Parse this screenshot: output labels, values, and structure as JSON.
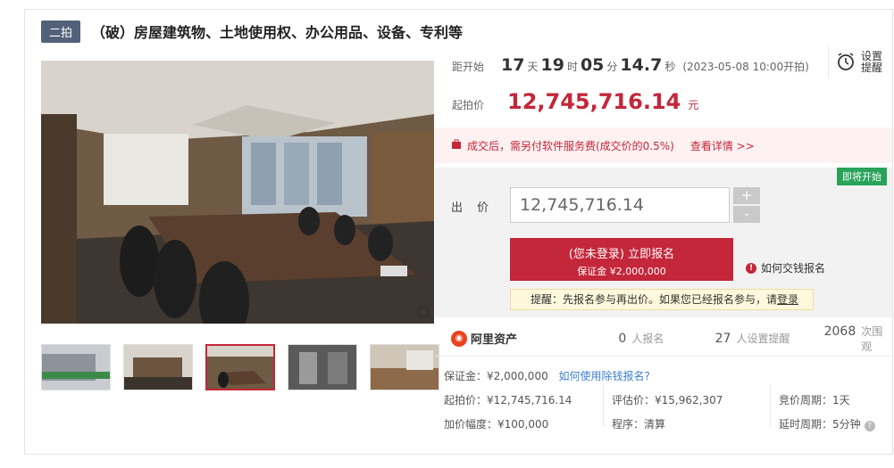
{
  "title": {
    "round_tag": "二拍",
    "text": "（破）房屋建筑物、土地使用权、办公用品、设备、专利等"
  },
  "countdown": {
    "label": "距开始",
    "days": "17",
    "days_unit": "天",
    "hours": "19",
    "hours_unit": "时",
    "minutes": "05",
    "minutes_unit": "分",
    "seconds": "14.7",
    "seconds_unit": "秒",
    "start_note": "(2023-05-08 10:00开拍)"
  },
  "reminder": {
    "line1": "设置",
    "line2": "提醒",
    "icon": "alarm-clock-icon"
  },
  "start_price": {
    "label": "起拍价",
    "value": "12,745,716.14",
    "unit": "元"
  },
  "fee_notice": {
    "text": "成交后，需另付软件服务费(成交价的0.5%)",
    "link": "查看详情 >>"
  },
  "bid": {
    "badge": "即将开始",
    "label": "出 价",
    "input_value": "12,745,716.14",
    "plus": "+",
    "minus": "-",
    "register_line1": "(您未登录) 立即报名",
    "register_line2": "保证金 ¥2,000,000",
    "how_pay": "如何交钱报名",
    "tip_text": "提醒：先报名参与再出价。如果您已经报名参与，请",
    "tip_login": "登录"
  },
  "stats": {
    "brand": "阿里资产",
    "registered_count": "0",
    "registered_label": "人报名",
    "reminder_count": "27",
    "reminder_label": "人设置提醒",
    "views_count": "2068",
    "views_label": "次围观"
  },
  "details": {
    "deposit": "保证金：¥2,000,000",
    "deposit_link": "如何使用除钱报名?",
    "start_price": "起拍价：¥12,745,716.14",
    "assessed_price": "评估价：¥15,962,307",
    "bid_cycle": "竞价周期：1天",
    "increment": "加价幅度：¥100,000",
    "procedure": "程序：清算",
    "delay_cycle": "延时周期：5分钟"
  },
  "colors": {
    "accent": "#c4263a",
    "tag_bg": "#52617a",
    "badge_green": "#29a35a",
    "link": "#3b7fd2"
  }
}
